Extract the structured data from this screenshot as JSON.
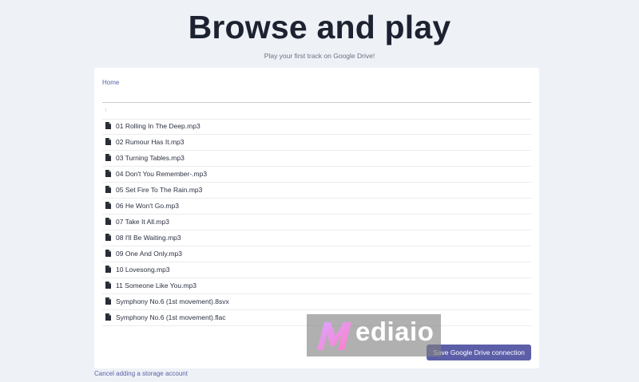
{
  "header": {
    "title": "Browse and play",
    "subtitle": "Play your first track on Google Drive!"
  },
  "browser": {
    "breadcrumb": "Home",
    "up_icon": "arrow-up-icon",
    "file_icon": "file-icon",
    "files": [
      "01 Rolling In The Deep.mp3",
      "02 Rumour Has It.mp3",
      "03 Turning Tables.mp3",
      "04 Don't You Remember-.mp3",
      "05 Set Fire To The Rain.mp3",
      "06 He Won't Go.mp3",
      "07 Take It All.mp3",
      "08 I'll Be Waiting.mp3",
      "09 One And Only.mp3",
      "10 Lovesong.mp3",
      "11 Someone Like You.mp3",
      "Symphony No.6 (1st movement).8svx",
      "Symphony No.6 (1st movement).flac"
    ]
  },
  "actions": {
    "save_label": "Save Google Drive connection",
    "cancel_label": "Cancel adding a storage account"
  },
  "watermark": {
    "text": "ediaio"
  },
  "colors": {
    "background": "#eef1f6",
    "accent": "#5c5fa8",
    "link": "#5a63a8",
    "text": "#2d3142"
  }
}
